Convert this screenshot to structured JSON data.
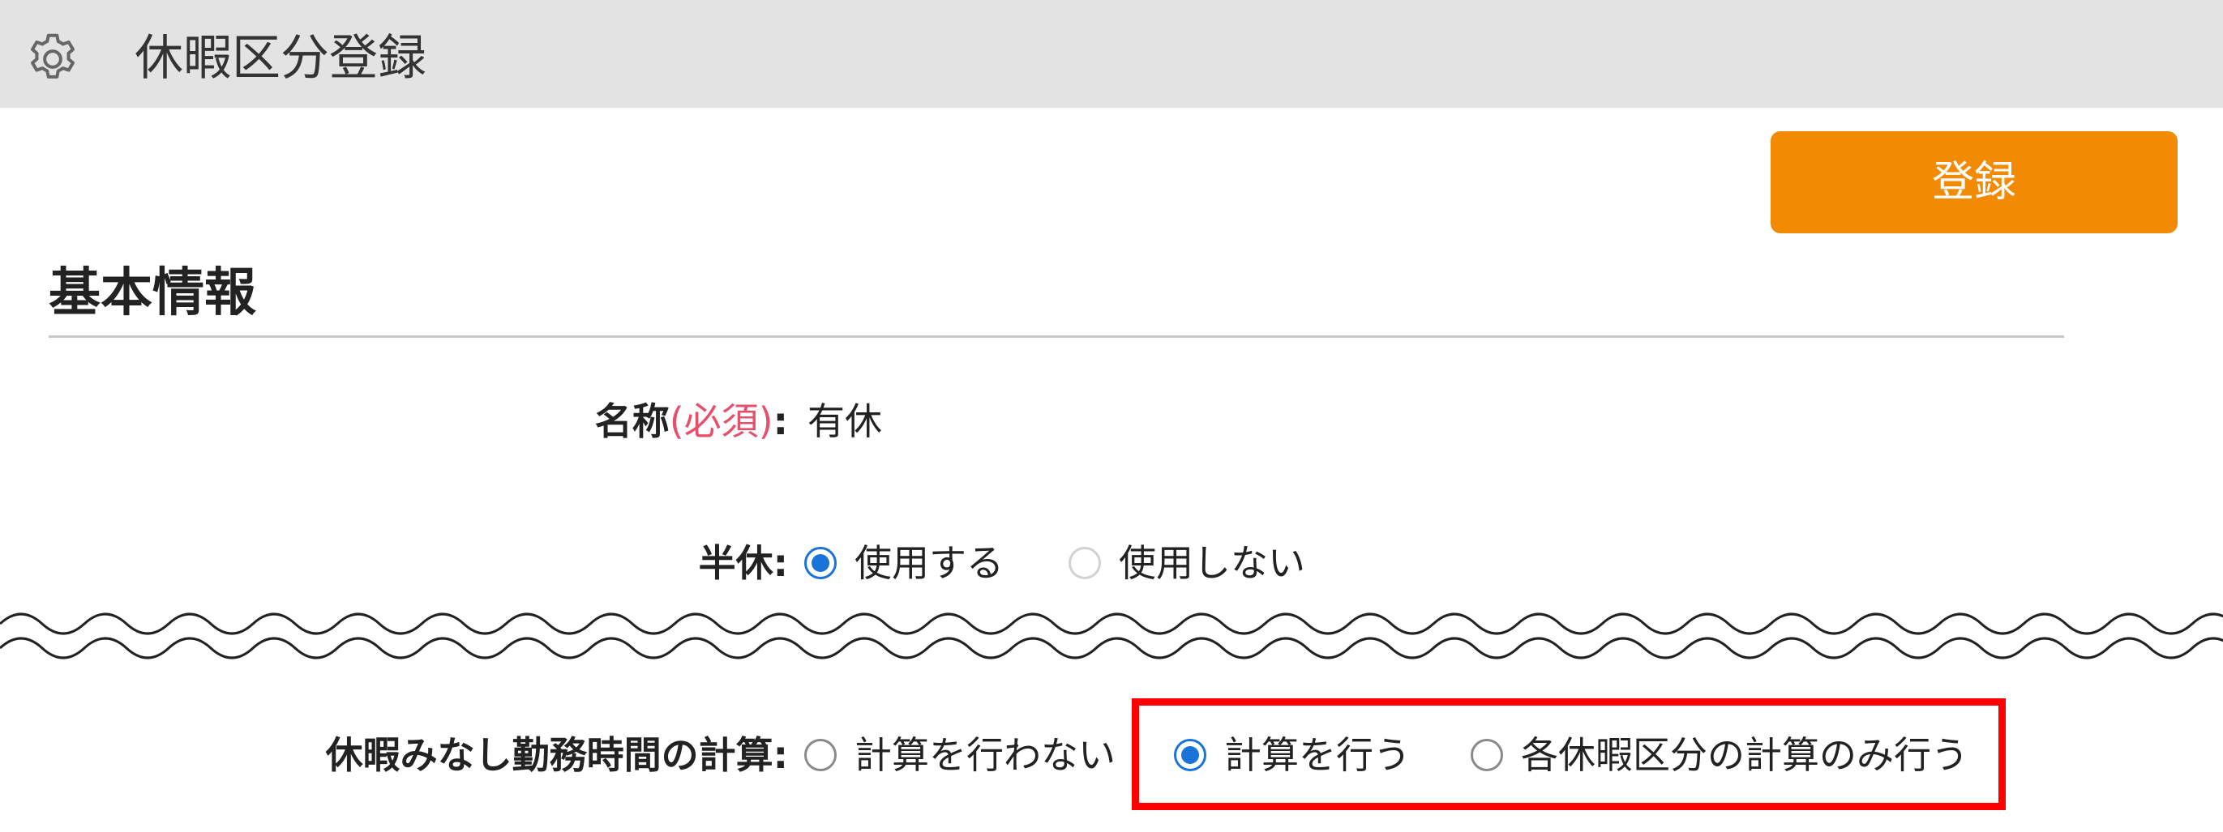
{
  "header": {
    "icon": "gear-icon",
    "title": "休暇区分登録"
  },
  "toolbar": {
    "register_label": "登録",
    "register_color": "#f28a04"
  },
  "section": {
    "title": "基本情報"
  },
  "fields": {
    "name": {
      "label": "名称",
      "required_mark": "(必須)",
      "colon": ":",
      "value": "有休"
    },
    "half_day": {
      "label": "半休:",
      "options": [
        {
          "label": "使用する",
          "checked": true
        },
        {
          "label": "使用しない",
          "checked": false
        }
      ]
    },
    "deemed_work_calc": {
      "label": "休暇みなし勤務時間の計算:",
      "options": [
        {
          "label": "計算を行わない",
          "checked": false
        },
        {
          "label": "計算を行う",
          "checked": true
        },
        {
          "label": "各休暇区分の計算のみ行う",
          "checked": false
        }
      ]
    }
  },
  "colors": {
    "header_bg": "#e3e3e3",
    "required": "#e5506a",
    "radio_selected": "#1a73d9",
    "highlight": "#ff0000"
  }
}
